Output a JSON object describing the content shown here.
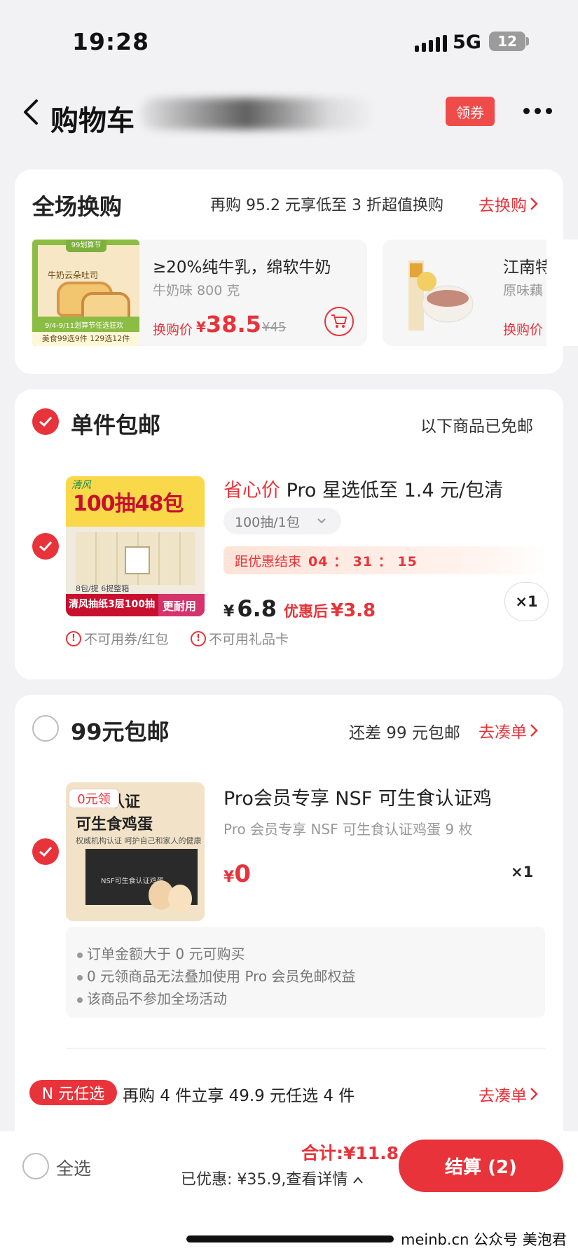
{
  "status": {
    "time": "19:28",
    "network": "5G",
    "battery": "12"
  },
  "nav": {
    "title": "购物车",
    "coupon_label": "领券"
  },
  "swap": {
    "title": "全场换购",
    "desc": "再购 95.2 元享低至 3 折超值换购",
    "go_label": "去换购",
    "products": [
      {
        "image_top_tag": "99划算节",
        "image_name": "牛奶云朵吐司",
        "image_band_text": "9/4-9/11划算节任选狂欢",
        "image_bottom_text": "美食99选9件 129选12件",
        "name": "≥20%纯牛乳，绵软牛奶",
        "spec": "牛奶味 800 克",
        "price_label": "换购价",
        "currency": "¥",
        "price": "38.5",
        "orig_price": "¥45"
      },
      {
        "name": "江南特",
        "spec": "原味藕",
        "price_label": "换购价"
      }
    ]
  },
  "single": {
    "title": "单件包邮",
    "right_text": "以下商品已免邮",
    "product": {
      "image_logo": "清风",
      "image_big": "100抽48包",
      "image_small": "8包/提 6提整箱",
      "image_bottom": "清风抽纸3层100抽",
      "image_badge": "更耐用",
      "title_highlight": "省心价",
      "title_rest": " Pro 星选低至 1.4 元/包清",
      "spec": "100抽/1包",
      "countdown_label": "距优惠结束",
      "countdown": "04 ： 31 ： 15",
      "currency": "¥",
      "price": "6.8",
      "after_label": "优惠后",
      "after_price": "¥3.8",
      "qty": "×1",
      "warn1": "不可用券/红包",
      "warn2": "不可用礼品卡"
    }
  },
  "free99": {
    "title": "99元包邮",
    "right_text": "还差 99 元包邮",
    "go_label": "去凑单",
    "product": {
      "tag": "0元领",
      "image_t1": "认证",
      "image_t2": "可生食鸡蛋",
      "image_t3": "权威机构认证 呵护自己和家人的健康",
      "image_box": "NSF可生食认证鸡蛋",
      "title": "Pro会员专享 NSF 可生食认证鸡",
      "sub": "Pro 会员专享 NSF 可生食认证鸡蛋 9 枚",
      "currency": "¥",
      "price": "0",
      "qty": "×1"
    },
    "notes": [
      "订单金额大于 0 元可购买",
      "0 元领商品无法叠加使用 Pro 会员免邮权益",
      "该商品不参加全场活动"
    ],
    "n_tag": "N 元任选",
    "n_desc": "再购 4 件立享 49.9 元任选 4 件",
    "n_go": "去凑单"
  },
  "bottom": {
    "select_all": "全选",
    "total": "合计:¥11.8",
    "saved": "已优惠: ¥35.9,查看详情",
    "checkout": "结算 (2)"
  },
  "watermark": "meinb.cn 公众号 美泡君",
  "colors": {
    "accent": "#e8333a",
    "background": "#f2f2f4",
    "card": "#ffffff"
  }
}
